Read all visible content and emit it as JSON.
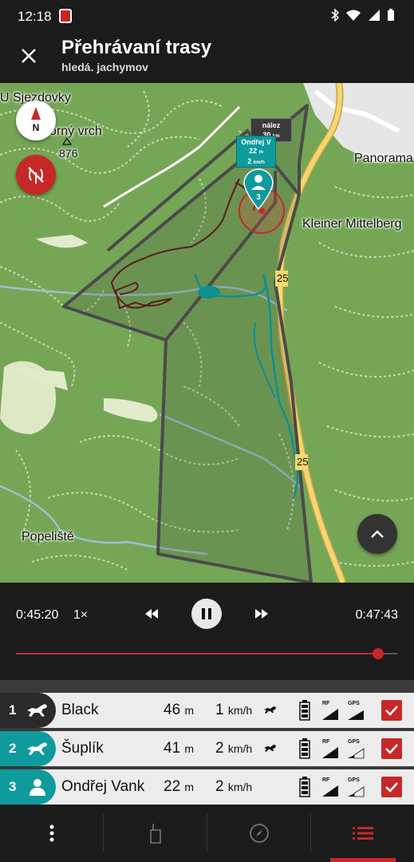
{
  "status_bar": {
    "time": "12:18"
  },
  "app_bar": {
    "title": "Přehrávaní trasy",
    "subtitle": "hledá. jachymov"
  },
  "map": {
    "labels": {
      "sjezdovky": "U Sjezdovky",
      "hill": "orný vrch",
      "hill_alt": "876",
      "panorama": "Panorama",
      "kleiner": "Kleiner Mittelberg",
      "popeliste": "Popeliště",
      "road_a": "25",
      "road_b": "25"
    },
    "marker_find": {
      "title": "nález",
      "dist": "30",
      "dist_unit": "km"
    },
    "marker_dog": {
      "name": "Ondřej V",
      "dist": "22",
      "dist_unit": "m",
      "speed": "2",
      "speed_unit": "km/h",
      "number": "3"
    },
    "compass_label": "N"
  },
  "player": {
    "time_current": "0:45:20",
    "speed": "1×",
    "time_total": "0:47:43",
    "progress": 0.95
  },
  "dogs": [
    {
      "number": "1",
      "name": "Black",
      "distance": "46",
      "distance_unit": "m",
      "speed": "1",
      "speed_unit": "km/h",
      "color": "#2a2a2a",
      "icon": "running-dog-icon",
      "rf_label": "RF",
      "gps_label": "GPS",
      "checked": true
    },
    {
      "number": "2",
      "name": "Šuplík",
      "distance": "41",
      "distance_unit": "m",
      "speed": "2",
      "speed_unit": "km/h",
      "color": "#0f9a9e",
      "icon": "running-dog-icon",
      "rf_label": "RF",
      "gps_label": "GPS",
      "checked": true
    },
    {
      "number": "3",
      "name": "Ondřej Vank",
      "distance": "22",
      "distance_unit": "m",
      "speed": "2",
      "speed_unit": "km/h",
      "color": "#0f9a9e",
      "icon": "person-icon",
      "rf_label": "RF",
      "gps_label": "GPS",
      "checked": true
    }
  ],
  "nav": {
    "items": [
      "more-icon",
      "device-icon",
      "compass-icon",
      "list-icon"
    ],
    "active": "list-icon"
  },
  "colors": {
    "accent": "#c62828",
    "teal": "#0f9a9e",
    "map_green": "#75a656"
  }
}
